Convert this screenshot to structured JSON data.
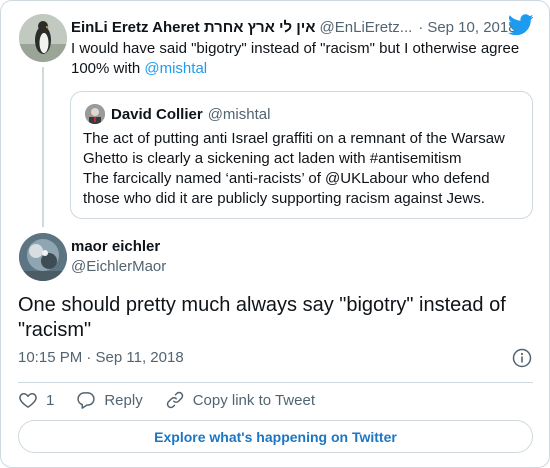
{
  "parent_tweet": {
    "author_name": "EinLi Eretz Aheret אין לי ארץ אחרת",
    "author_handle": "@EnLiEretz...",
    "separator": "·",
    "date": "Sep 10, 2018",
    "text_before_link": "I would have said \"bigotry\" instead of \"racism\" but I otherwise agree 100% with ",
    "link_text": "@mishtal"
  },
  "quoted_tweet": {
    "author_name": "David Collier",
    "author_handle": "@mishtal",
    "lines": [
      "The act of putting anti Israel graffiti on a remnant of the Warsaw",
      "Ghetto is clearly a sickening act laden with #antisemitism",
      "The farcically named ‘anti-racists’ of @UKLabour who defend",
      "those who did it are publicly supporting racism against Jews."
    ]
  },
  "main_tweet": {
    "author_name": "maor eichler",
    "author_handle": "@EichlerMaor",
    "text": "One should pretty much always say \"bigotry\" instead of \"racism\"",
    "timestamp": "10:15 PM · Sep 11, 2018"
  },
  "actions": {
    "like_count": "1",
    "reply_label": "Reply",
    "copy_link_label": "Copy link to Tweet"
  },
  "explore_label": "Explore what's happening on Twitter",
  "colors": {
    "accent": "#1d9bf0",
    "text": "#0f1419",
    "secondary": "#536471",
    "border": "#cfd9de"
  },
  "icons": [
    "twitter-bird-icon",
    "info-icon",
    "heart-icon",
    "reply-icon",
    "link-icon"
  ]
}
